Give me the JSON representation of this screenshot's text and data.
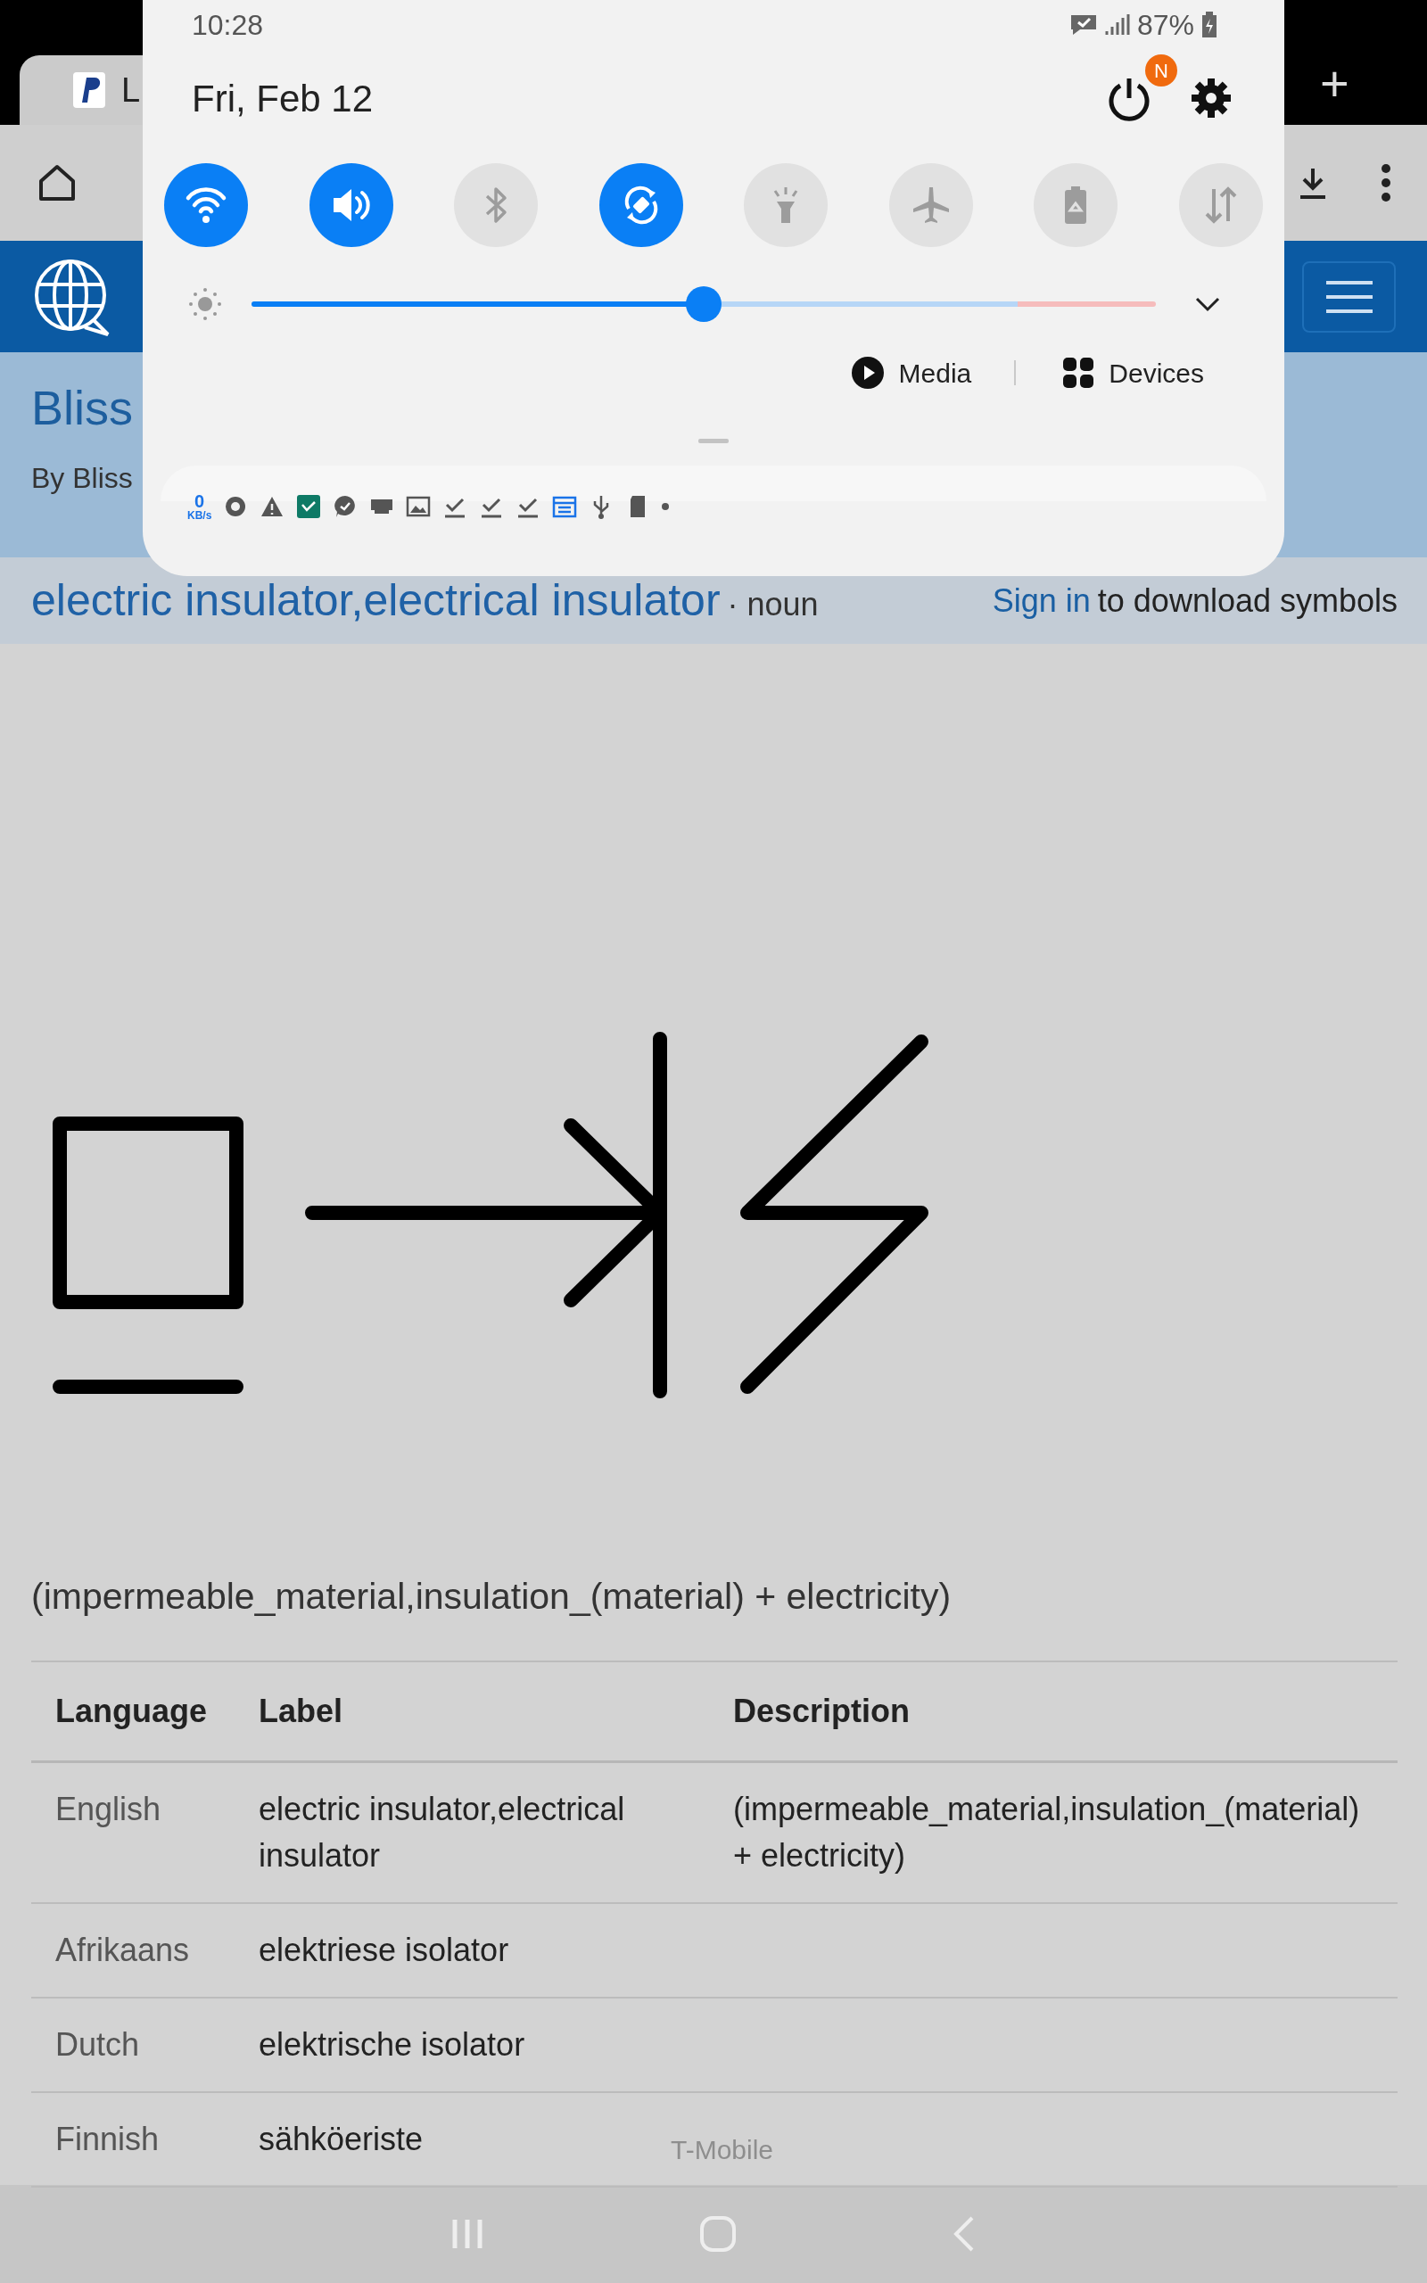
{
  "browser": {
    "tab_title": "L",
    "new_tab": "+"
  },
  "site": {
    "title": "Bliss",
    "byline": "By Bliss",
    "word": "electric insulator,electrical insulator",
    "part_of_speech": "· noun",
    "sign_in_link": "Sign in",
    "sign_in_text": "to download symbols",
    "description": "(impermeable_material,insulation_(material) + electricity)",
    "table": {
      "columns": [
        "Language",
        "Label",
        "Description"
      ],
      "rows": [
        {
          "language": "English",
          "label": "electric insulator,electrical insulator",
          "description": "(impermeable_material,insulation_(material) + electricity)"
        },
        {
          "language": "Afrikaans",
          "label": "elektriese isolator"
        },
        {
          "language": "Dutch",
          "label": "elektrische isolator"
        },
        {
          "language": "Finnish",
          "label": "sähköeriste"
        }
      ]
    }
  },
  "carrier": "T-Mobile",
  "quick_panel": {
    "time": "10:28",
    "battery": "87%",
    "date": "Fri, Feb 12",
    "power_badge": "N",
    "toggles": [
      {
        "kind": "wifi",
        "on": true
      },
      {
        "kind": "sound",
        "on": true
      },
      {
        "kind": "bluetooth",
        "on": false
      },
      {
        "kind": "rotate",
        "on": true
      },
      {
        "kind": "flashlight",
        "on": false
      },
      {
        "kind": "airplane",
        "on": false
      },
      {
        "kind": "battery",
        "on": false
      },
      {
        "kind": "data",
        "on": false
      }
    ],
    "brightness": {
      "level": 0.5
    },
    "media_button": "Media",
    "devices_button": "Devices",
    "speed_value": "0",
    "speed_unit": "KB/s"
  }
}
